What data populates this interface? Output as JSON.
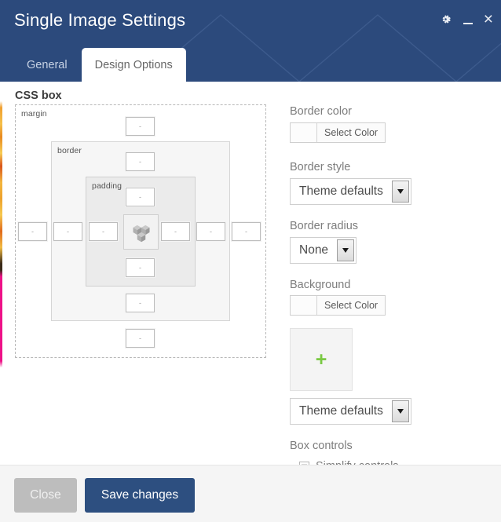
{
  "window": {
    "title": "Single Image Settings",
    "controls": [
      {
        "name": "gear-icon",
        "glyph": "settings"
      },
      {
        "name": "minimize-icon",
        "glyph": "_"
      },
      {
        "name": "close-icon",
        "glyph": "×"
      }
    ],
    "header_bg": "#2c4a7c"
  },
  "tabs": [
    {
      "label": "General",
      "active": false
    },
    {
      "label": "Design Options",
      "active": true
    }
  ],
  "main": {
    "section_title": "CSS box",
    "cssbox": {
      "regions": {
        "margin": "margin",
        "border": "border",
        "padding": "padding"
      },
      "content_icon": "cube-icon",
      "input_placeholder": "-",
      "inputs": [
        {
          "name": "margin-top-input",
          "value": "",
          "placeholder": "-"
        },
        {
          "name": "border-top-input",
          "value": "",
          "placeholder": "-"
        },
        {
          "name": "padding-top-input",
          "value": "",
          "placeholder": "-"
        },
        {
          "name": "padding-bottom-input",
          "value": "",
          "placeholder": "-"
        },
        {
          "name": "border-bottom-input",
          "value": "",
          "placeholder": "-"
        },
        {
          "name": "margin-bottom-input",
          "value": "",
          "placeholder": "-"
        },
        {
          "name": "margin-left-input",
          "value": "",
          "placeholder": "-"
        },
        {
          "name": "border-left-input",
          "value": "",
          "placeholder": "-"
        },
        {
          "name": "padding-left-input",
          "value": "",
          "placeholder": "-"
        },
        {
          "name": "padding-right-input",
          "value": "",
          "placeholder": "-"
        },
        {
          "name": "border-right-input",
          "value": "",
          "placeholder": "-"
        },
        {
          "name": "margin-right-input",
          "value": "",
          "placeholder": "-"
        }
      ]
    }
  },
  "panel": {
    "border_color": {
      "label": "Border color",
      "button_label": "Select Color",
      "swatch": "#fcfcfc"
    },
    "border_style": {
      "label": "Border style",
      "value": "Theme defaults"
    },
    "border_radius": {
      "label": "Border radius",
      "value": "None"
    },
    "background": {
      "label": "Background",
      "button_label": "Select Color",
      "swatch": "#fcfcfc",
      "upload_icon": "+",
      "upload_icon_color": "#7ac943",
      "style_value": "Theme defaults"
    },
    "box_controls": {
      "label": "Box controls",
      "simplify_label": "Simplify controls",
      "simplify_checked": false
    }
  },
  "footer": {
    "close_label": "Close",
    "save_label": "Save changes",
    "save_color": "#2d4f80",
    "close_color": "#bdbdbd"
  }
}
